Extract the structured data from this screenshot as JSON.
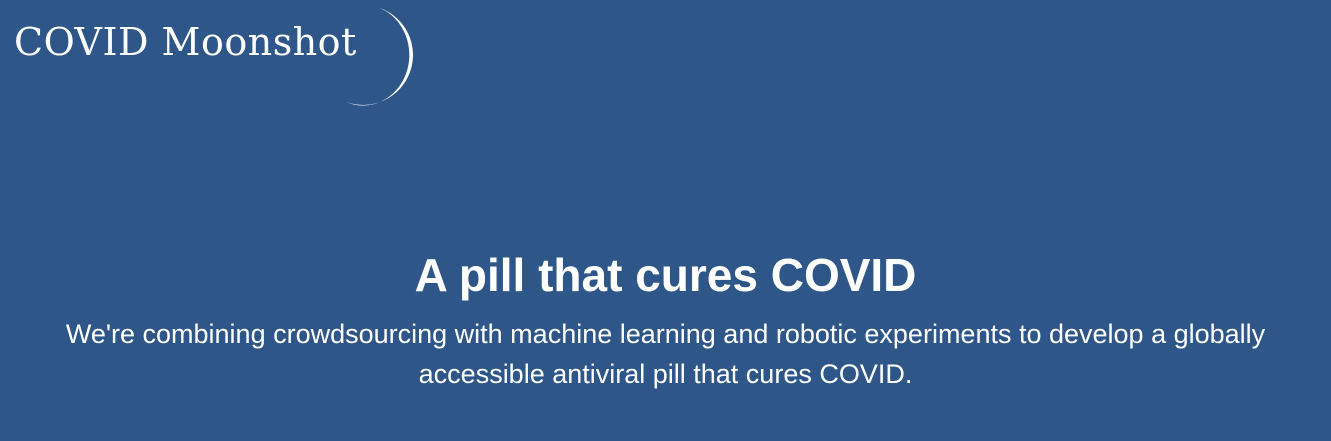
{
  "header": {
    "logo_text": "COVID Moonshot",
    "logo_icon": "crescent-moon-icon"
  },
  "hero": {
    "title": "A pill that cures COVID",
    "subtitle": "We're combining crowdsourcing with machine learning and robotic experiments to develop a globally accessible antiviral pill that cures COVID."
  },
  "colors": {
    "background": "#2e5689",
    "text": "#ffffff"
  }
}
